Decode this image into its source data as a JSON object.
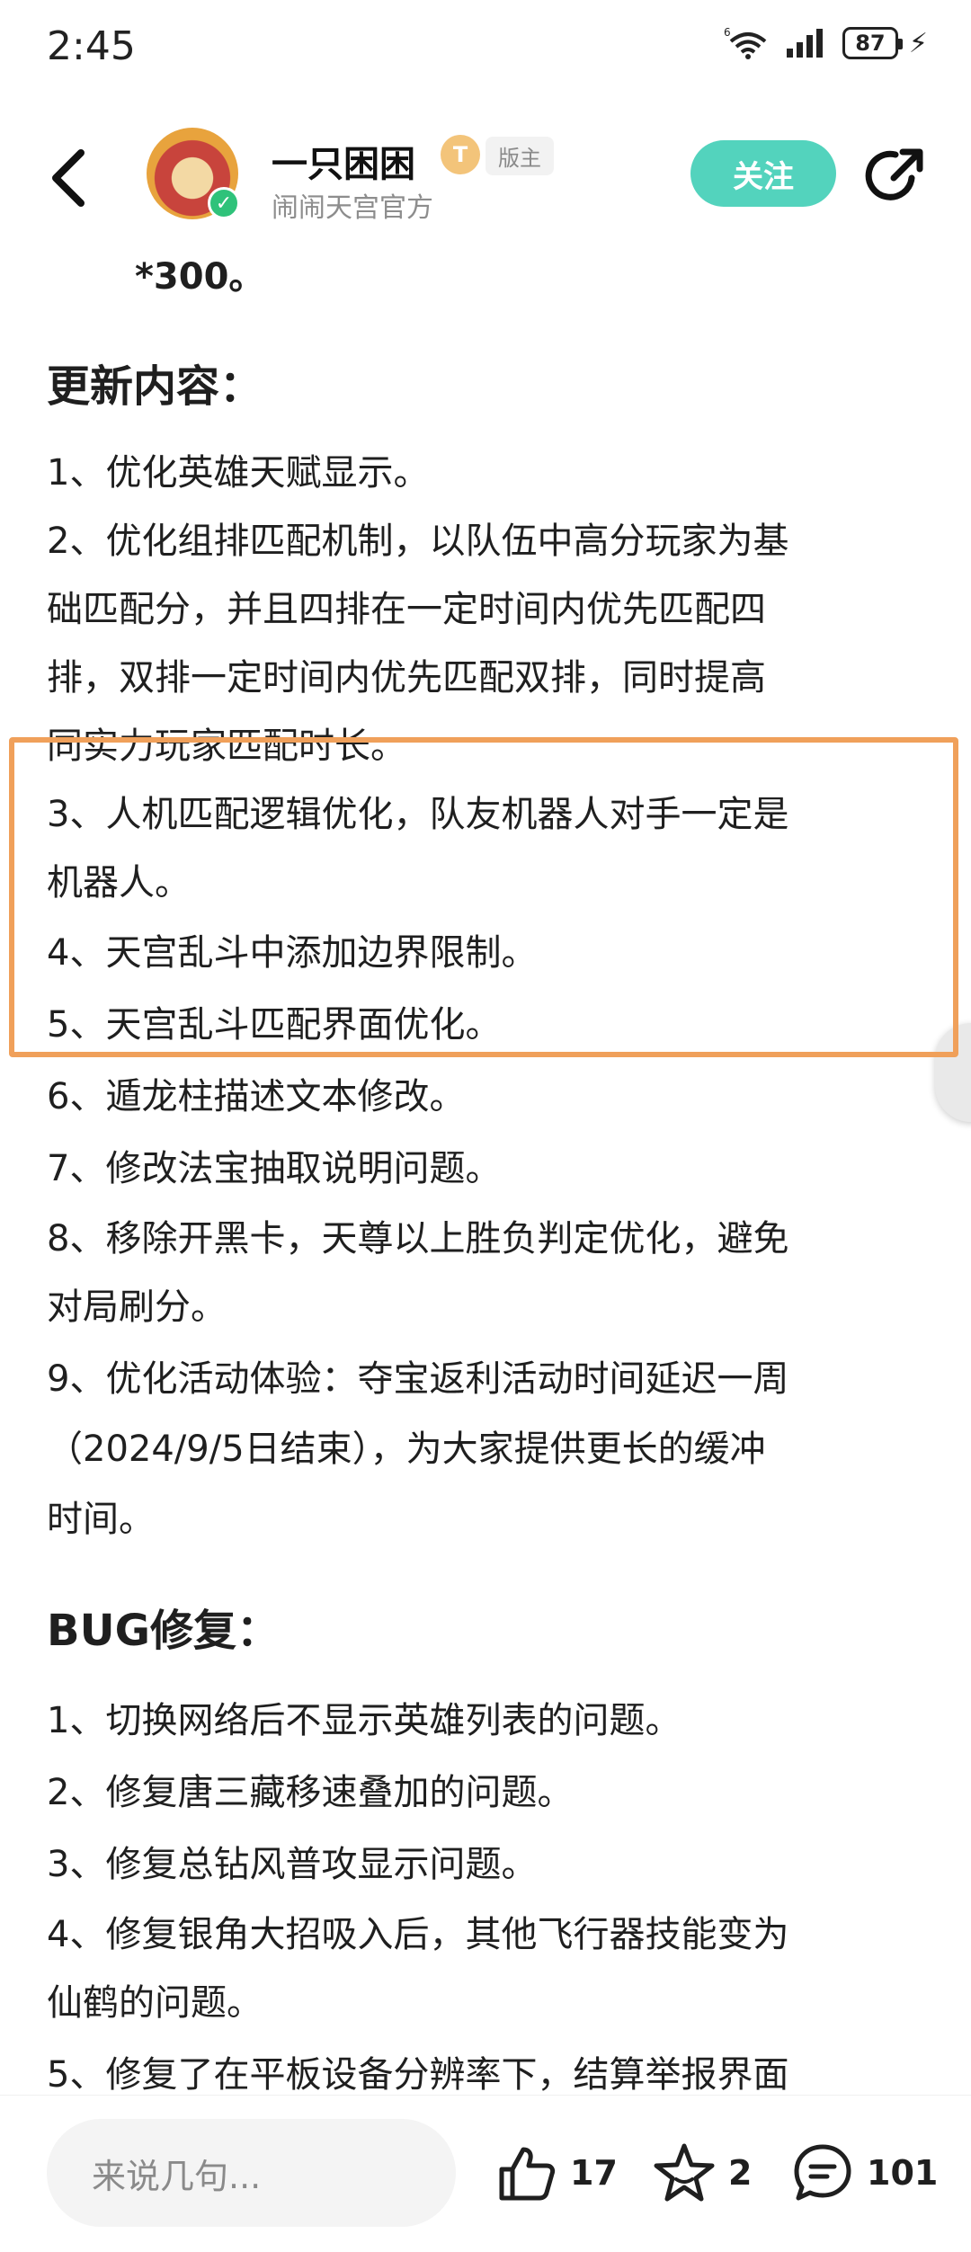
{
  "status_bar": {
    "time": "2:45",
    "battery": "87"
  },
  "header": {
    "author_name": "一只困困",
    "level_badge": "T",
    "role_badge": "版主",
    "subtitle": "闹闹天宫官方",
    "follow_label": "关注"
  },
  "article": {
    "lines": {
      "l0": "*300。",
      "h1": "更新内容：",
      "l1": "1、优化英雄天赋显示。",
      "l2a": "2、优化组排匹配机制，以队伍中高分玩家为基",
      "l2b": "础匹配分，并且四排在一定时间内优先匹配四",
      "l2c": "排，双排一定时间内优先匹配双排，同时提高",
      "l2d": "同实力玩家匹配时长。",
      "l3a": "3、人机匹配逻辑优化，队友机器人对手一定是",
      "l3b": "机器人。",
      "l4": "4、天宫乱斗中添加边界限制。",
      "l5": "5、天宫乱斗匹配界面优化。",
      "l6": "6、遁龙柱描述文本修改。",
      "l7": "7、修改法宝抽取说明问题。",
      "l8a": "8、移除开黑卡，天尊以上胜负判定优化，避免",
      "l8b": "对局刷分。",
      "l9a": "9、优化活动体验：夺宝返利活动时间延迟一周",
      "l9b": "（2024/9/5日结束），为大家提供更长的缓冲",
      "l9c": "时间。",
      "h2": "BUG修复：",
      "b1": "1、切换网络后不显示英雄列表的问题。",
      "b2": "2、修复唐三藏移速叠加的问题。",
      "b3": "3、修复总钻风普攻显示问题。",
      "b4a": "4、修复银角大招吸入后，其他飞行器技能变为",
      "b4b": "仙鹤的问题。",
      "b5": "5、修复了在平板设备分辨率下，结算举报界面"
    }
  },
  "bottom_bar": {
    "comment_placeholder": "来说几句...",
    "likes": "17",
    "favorites": "2",
    "comments": "101"
  }
}
